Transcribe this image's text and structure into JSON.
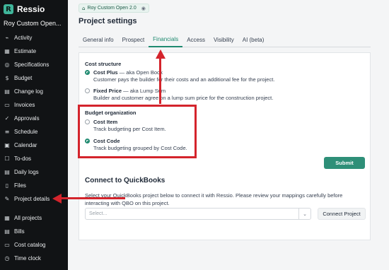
{
  "sidebar": {
    "brand": "Ressio",
    "project": "Roy Custom Open...",
    "items": [
      {
        "label": "Activity",
        "icon": "activity-icon",
        "glyph": "⌁"
      },
      {
        "label": "Estimate",
        "icon": "estimate-icon",
        "glyph": "▦"
      },
      {
        "label": "Specifications",
        "icon": "specifications-icon",
        "glyph": "◎"
      },
      {
        "label": "Budget",
        "icon": "budget-icon",
        "glyph": "$"
      },
      {
        "label": "Change log",
        "icon": "change-log-icon",
        "glyph": "▤"
      },
      {
        "label": "Invoices",
        "icon": "invoices-icon",
        "glyph": "▭"
      },
      {
        "label": "Approvals",
        "icon": "approvals-icon",
        "glyph": "✓"
      },
      {
        "label": "Schedule",
        "icon": "schedule-icon",
        "glyph": "≡"
      },
      {
        "label": "Calendar",
        "icon": "calendar-icon",
        "glyph": "▣"
      },
      {
        "label": "To-dos",
        "icon": "todos-icon",
        "glyph": "☐"
      },
      {
        "label": "Daily logs",
        "icon": "daily-logs-icon",
        "glyph": "▤"
      },
      {
        "label": "Files",
        "icon": "files-icon",
        "glyph": "▯"
      },
      {
        "label": "Project details",
        "icon": "project-details-icon",
        "glyph": "✎"
      }
    ],
    "bottom_items": [
      {
        "label": "All projects",
        "icon": "all-projects-icon",
        "glyph": "▦"
      },
      {
        "label": "Bills",
        "icon": "bills-icon",
        "glyph": "▤"
      },
      {
        "label": "Cost catalog",
        "icon": "cost-catalog-icon",
        "glyph": "▭"
      },
      {
        "label": "Time clock",
        "icon": "time-clock-icon",
        "glyph": "◷"
      }
    ]
  },
  "header": {
    "chip_label": "Roy Custom Open 2.0",
    "page_title": "Project settings"
  },
  "tabs": [
    {
      "label": "General info",
      "active": false
    },
    {
      "label": "Prospect",
      "active": false
    },
    {
      "label": "Financials",
      "active": true
    },
    {
      "label": "Access",
      "active": false
    },
    {
      "label": "Visibility",
      "active": false
    },
    {
      "label": "AI (beta)",
      "active": false
    }
  ],
  "cost_structure": {
    "label": "Cost structure",
    "options": [
      {
        "title": "Cost Plus",
        "aka": " — aka Open Book",
        "desc": "Customer pays the builder for their costs and an additional fee for the project.",
        "selected": true
      },
      {
        "title": "Fixed Price",
        "aka": " — aka Lump Sum",
        "desc": "Builder and customer agree on a lump sum price for the construction project.",
        "selected": false
      }
    ]
  },
  "budget_org": {
    "label": "Budget organization",
    "options": [
      {
        "title": "Cost Item",
        "desc": "Track budgeting per Cost Item.",
        "selected": false
      },
      {
        "title": "Cost Code",
        "desc": "Track budgeting grouped by Cost Code.",
        "selected": true
      }
    ]
  },
  "submit_label": "Submit",
  "quickbooks": {
    "title": "Connect to QuickBooks",
    "description": "Select your QuickBooks project below to connect it with Ressio. Please review your mappings carefully before interacting with QBO on this project.",
    "select_placeholder": "Select...",
    "connect_label": "Connect Project"
  },
  "colors": {
    "accent": "#1f8a70",
    "annotation_red": "#d4242c",
    "sidebar_bg": "#111315"
  }
}
